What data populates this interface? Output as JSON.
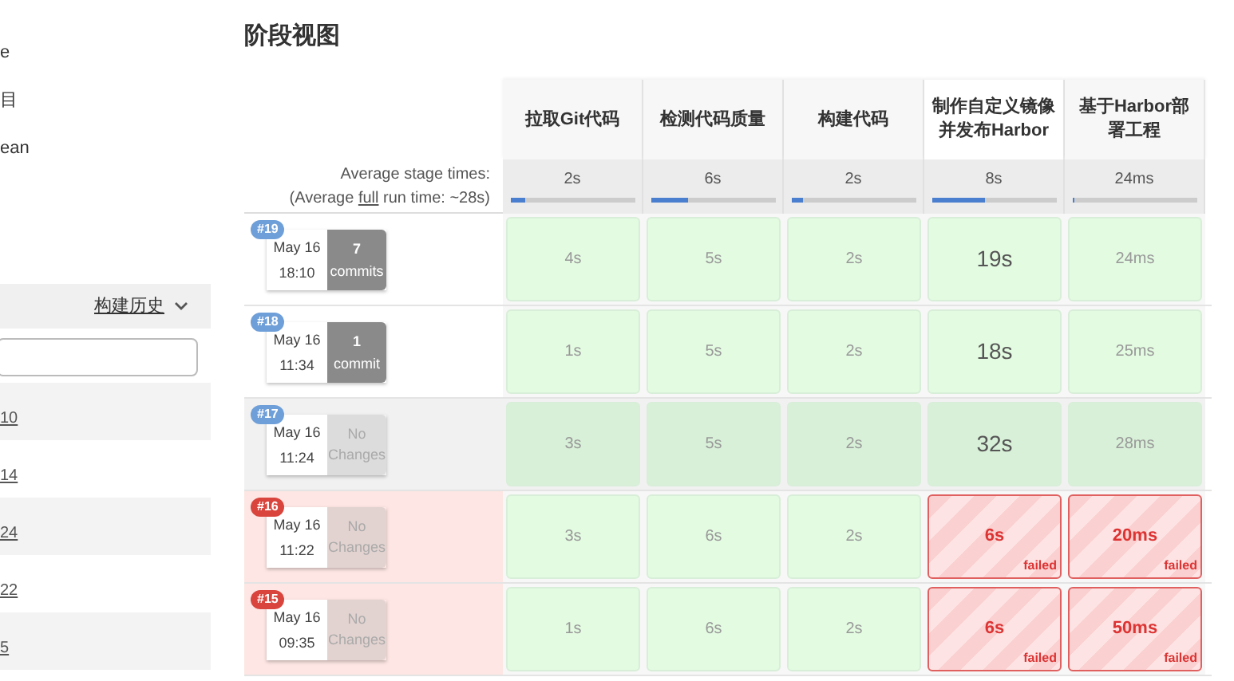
{
  "sidebar": {
    "top_items": [
      "e",
      "目",
      "ean"
    ],
    "build_history": {
      "title": "构建历史",
      "rows": [
        "10",
        "14",
        "24",
        "22",
        "5"
      ]
    }
  },
  "title": "阶段视图",
  "average": {
    "label": "Average stage times:",
    "full_prefix": "(Average ",
    "full_link": "full",
    "full_suffix": " run time: ~28s)"
  },
  "stages": [
    {
      "name": "拉取Git代码",
      "avg": "2s",
      "level": 0.12
    },
    {
      "name": "检测代码质量",
      "avg": "6s",
      "level": 0.3
    },
    {
      "name": "构建代码",
      "avg": "2s",
      "level": 0.1
    },
    {
      "name": "制作自定义镜像并发布Harbor",
      "avg": "8s",
      "level": 0.43
    },
    {
      "name": "基于Harbor部署工程",
      "avg": "24ms",
      "level": 0.02
    }
  ],
  "builds": [
    {
      "number": "#19",
      "date": "May 16",
      "time": "18:10",
      "changes": {
        "kind": "commits",
        "count": "7",
        "label": "commits"
      },
      "failed": false,
      "selected": false,
      "cells": [
        {
          "text": "4s",
          "failed": false,
          "long": false
        },
        {
          "text": "5s",
          "failed": false,
          "long": false
        },
        {
          "text": "2s",
          "failed": false,
          "long": false
        },
        {
          "text": "19s",
          "failed": false,
          "long": true
        },
        {
          "text": "24ms",
          "failed": false,
          "long": false
        }
      ]
    },
    {
      "number": "#18",
      "date": "May 16",
      "time": "11:34",
      "changes": {
        "kind": "commits",
        "count": "1",
        "label": "commit"
      },
      "failed": false,
      "selected": false,
      "cells": [
        {
          "text": "1s",
          "failed": false,
          "long": false
        },
        {
          "text": "5s",
          "failed": false,
          "long": false
        },
        {
          "text": "2s",
          "failed": false,
          "long": false
        },
        {
          "text": "18s",
          "failed": false,
          "long": true
        },
        {
          "text": "25ms",
          "failed": false,
          "long": false
        }
      ]
    },
    {
      "number": "#17",
      "date": "May 16",
      "time": "11:24",
      "changes": {
        "kind": "none",
        "label": "No Changes"
      },
      "failed": false,
      "selected": true,
      "cells": [
        {
          "text": "3s",
          "failed": false,
          "long": false
        },
        {
          "text": "5s",
          "failed": false,
          "long": false
        },
        {
          "text": "2s",
          "failed": false,
          "long": false
        },
        {
          "text": "32s",
          "failed": false,
          "long": true
        },
        {
          "text": "28ms",
          "failed": false,
          "long": false
        }
      ]
    },
    {
      "number": "#16",
      "date": "May 16",
      "time": "11:22",
      "changes": {
        "kind": "none",
        "label": "No Changes"
      },
      "failed": true,
      "selected": false,
      "cells": [
        {
          "text": "3s",
          "failed": false,
          "long": false
        },
        {
          "text": "6s",
          "failed": false,
          "long": false
        },
        {
          "text": "2s",
          "failed": false,
          "long": false
        },
        {
          "text": "6s",
          "failed": true,
          "long": false,
          "badge": "failed"
        },
        {
          "text": "20ms",
          "failed": true,
          "long": false,
          "badge": "failed"
        }
      ]
    },
    {
      "number": "#15",
      "date": "May 16",
      "time": "09:35",
      "changes": {
        "kind": "none",
        "label": "No Changes"
      },
      "failed": true,
      "selected": false,
      "cells": [
        {
          "text": "1s",
          "failed": false,
          "long": false
        },
        {
          "text": "6s",
          "failed": false,
          "long": false
        },
        {
          "text": "2s",
          "failed": false,
          "long": false
        },
        {
          "text": "6s",
          "failed": true,
          "long": false,
          "badge": "failed"
        },
        {
          "text": "50ms",
          "failed": true,
          "long": false,
          "badge": "failed"
        }
      ]
    }
  ]
}
